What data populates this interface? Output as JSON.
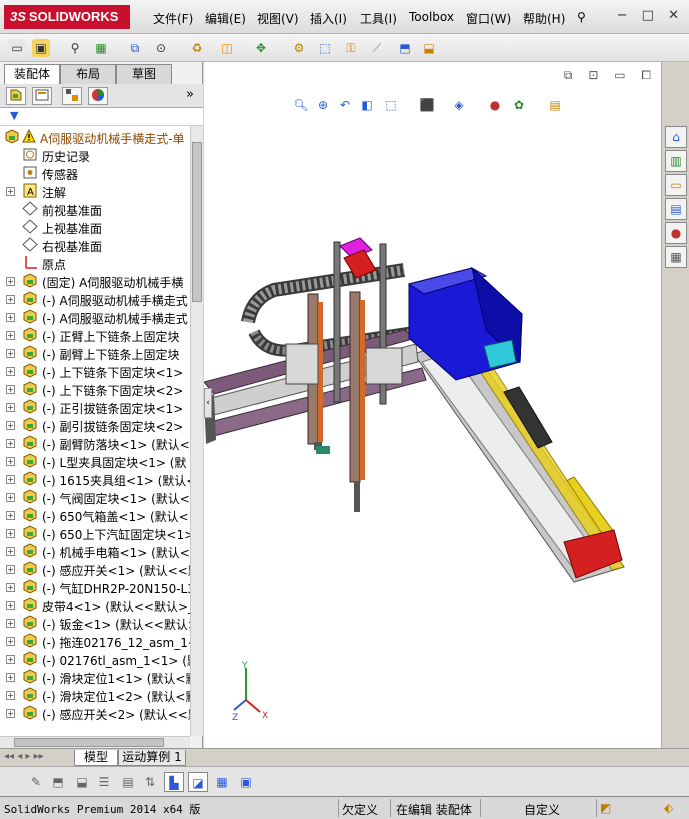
{
  "app": {
    "logo_text": "SOLIDWORKS",
    "logo_prefix": "3S"
  },
  "menu": {
    "items": [
      "文件(F)",
      "编辑(E)",
      "视图(V)",
      "插入(I)",
      "工具(I)",
      "Toolbox",
      "窗口(W)",
      "帮助(H)"
    ]
  },
  "window_controls": [
    "−",
    "□",
    "✕"
  ],
  "panel_tabs": [
    "装配体",
    "布局",
    "草图"
  ],
  "panel_icons": [
    "feature-manager-icon",
    "property-manager-icon",
    "configuration-manager-icon",
    "display-manager-icon"
  ],
  "expand_arrow": "»",
  "filter_icon": "▼",
  "tree": {
    "root_label": "A伺服驱动机械手横走式-单",
    "items": [
      {
        "label": "历史记录",
        "icon": "history-icon",
        "expandable": false
      },
      {
        "label": "传感器",
        "icon": "sensor-icon",
        "expandable": false
      },
      {
        "label": "注解",
        "icon": "annotation-icon",
        "expandable": true
      },
      {
        "label": "前视基准面",
        "icon": "plane-icon",
        "expandable": false
      },
      {
        "label": "上视基准面",
        "icon": "plane-icon",
        "expandable": false
      },
      {
        "label": "右视基准面",
        "icon": "plane-icon",
        "expandable": false
      },
      {
        "label": "原点",
        "icon": "origin-icon",
        "expandable": false
      },
      {
        "label": "(固定) A伺服驱动机械手横",
        "icon": "part-icon",
        "expandable": true
      },
      {
        "label": "(-) A伺服驱动机械手横走式",
        "icon": "part-icon",
        "expandable": true
      },
      {
        "label": "(-) A伺服驱动机械手横走式",
        "icon": "part-icon",
        "expandable": true
      },
      {
        "label": "(-) 正臂上下链条上固定块",
        "icon": "part-icon",
        "expandable": true
      },
      {
        "label": "(-) 副臂上下链条上固定块",
        "icon": "part-icon",
        "expandable": true
      },
      {
        "label": "(-) 上下链条下固定块<1>",
        "icon": "part-icon",
        "expandable": true
      },
      {
        "label": "(-) 上下链条下固定块<2>",
        "icon": "part-icon",
        "expandable": true
      },
      {
        "label": "(-) 正引拔链条固定块<1>",
        "icon": "part-icon",
        "expandable": true
      },
      {
        "label": "(-) 副引拔链条固定块<2>",
        "icon": "part-icon",
        "expandable": true
      },
      {
        "label": "(-) 副臂防落块<1> (默认<",
        "icon": "part-icon",
        "expandable": true
      },
      {
        "label": "(-) L型夹具固定块<1> (默",
        "icon": "part-icon",
        "expandable": true
      },
      {
        "label": "(-) 1615夹具组<1> (默认<",
        "icon": "part-icon",
        "expandable": true
      },
      {
        "label": "(-) 气阀固定块<1> (默认<<",
        "icon": "part-icon",
        "expandable": true
      },
      {
        "label": "(-) 650气箱盖<1> (默认<<",
        "icon": "part-icon",
        "expandable": true
      },
      {
        "label": "(-) 650上下汽缸固定块<1>",
        "icon": "part-icon",
        "expandable": true
      },
      {
        "label": "(-) 机械手电箱<1> (默认<<",
        "icon": "part-icon",
        "expandable": true
      },
      {
        "label": "(-) 感应开关<1> (默认<<默",
        "icon": "part-icon",
        "expandable": true
      },
      {
        "label": "(-) 气缸DHR2P-20N150-L35",
        "icon": "part-icon",
        "expandable": true
      },
      {
        "label": "皮带4<1> (默认<<默认>_显",
        "icon": "assembly-icon",
        "expandable": true
      },
      {
        "label": "(-) 钣金<1> (默认<<默认>",
        "icon": "part-icon",
        "expandable": true
      },
      {
        "label": "(-) 拖连02176_12_asm_1<1",
        "icon": "part-icon",
        "expandable": true
      },
      {
        "label": "(-) 02176tl_asm_1<1> (默",
        "icon": "part-icon",
        "expandable": true
      },
      {
        "label": "(-) 滑块定位1<1> (默认<默",
        "icon": "part-icon",
        "expandable": true
      },
      {
        "label": "(-) 滑块定位1<2> (默认<默",
        "icon": "part-icon",
        "expandable": true
      },
      {
        "label": "(-) 感应开关<2> (默认<<默",
        "icon": "part-icon",
        "expandable": true
      }
    ]
  },
  "bottom_tabs": [
    "模型",
    "运动算例 1"
  ],
  "statusbar": {
    "app_version": "SolidWorks Premium 2014 x64 版",
    "state1": "欠定义",
    "state2": "在编辑 装配体",
    "state3": "自定义"
  },
  "colors": {
    "accent": "#c8102e",
    "motor_blue": "#1a1ad6",
    "rail_purple": "#7b5a7a",
    "cyan_block": "#2ec8d8",
    "red_cap": "#d42020",
    "yellow_edge": "#e8d020"
  }
}
